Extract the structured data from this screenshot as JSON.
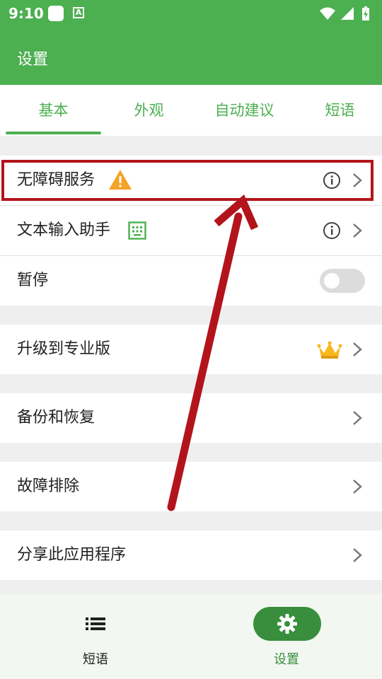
{
  "status_bar": {
    "time": "9:10"
  },
  "app_bar": {
    "title": "设置"
  },
  "tabs": [
    {
      "label": "基本",
      "selected": true
    },
    {
      "label": "外观",
      "selected": false
    },
    {
      "label": "自动建议",
      "selected": false
    },
    {
      "label": "短语",
      "selected": false
    }
  ],
  "settings": {
    "accessibility": {
      "label": "无障碍服务"
    },
    "input_assistant": {
      "label": "文本输入助手"
    },
    "pause": {
      "label": "暂停",
      "enabled": false
    },
    "upgrade": {
      "label": "升级到专业版"
    },
    "backup": {
      "label": "备份和恢复"
    },
    "troubleshoot": {
      "label": "故障排除"
    },
    "share": {
      "label": "分享此应用程序"
    }
  },
  "bottom_nav": [
    {
      "label": "短语",
      "icon": "list-icon",
      "selected": false
    },
    {
      "label": "设置",
      "icon": "gear-icon",
      "selected": true
    }
  ],
  "colors": {
    "accent": "#4caf50",
    "accent_dark": "#388e3c",
    "warning": "#f4a428",
    "annotation": "#b3141b"
  }
}
